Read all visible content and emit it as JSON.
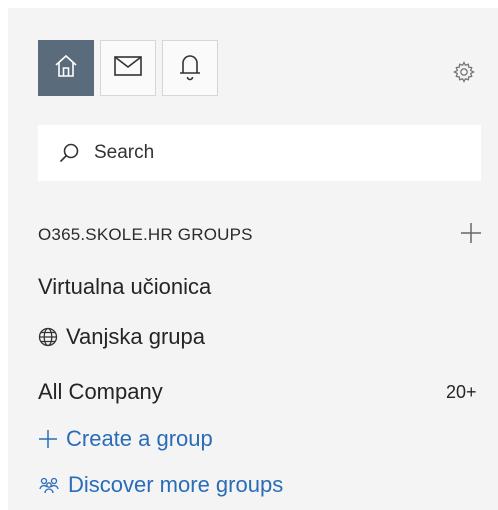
{
  "toolbar": {
    "home_icon": "home-icon",
    "mail_icon": "mail-icon",
    "bell_icon": "bell-icon",
    "settings_icon": "gear-icon"
  },
  "search": {
    "placeholder": "Search"
  },
  "groups": {
    "header": "O365.SKOLE.HR GROUPS",
    "items": [
      {
        "label": "Virtualna učionica",
        "icon": null,
        "count": ""
      },
      {
        "label": "Vanjska grupa",
        "icon": "globe-icon",
        "count": ""
      },
      {
        "label": "All Company",
        "icon": null,
        "count": "20+"
      }
    ],
    "create_label": "Create a group",
    "discover_label": "Discover more groups"
  },
  "colors": {
    "accent_link": "#2a6cb8",
    "active_tab_bg": "#5a6b7c",
    "panel_bg": "#f4f4f4"
  }
}
